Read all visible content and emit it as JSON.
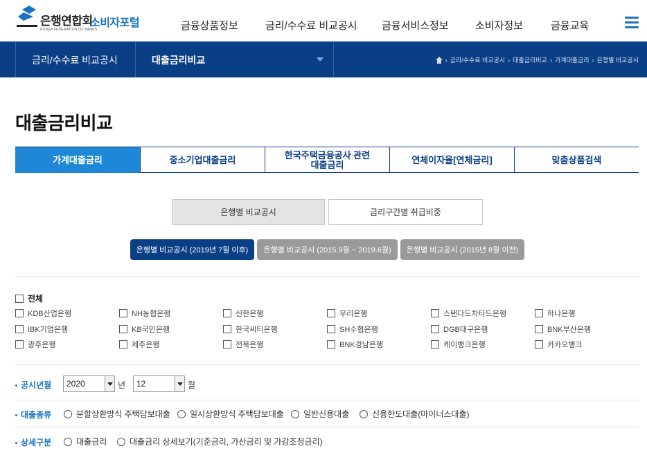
{
  "header": {
    "logo_kr": "은행연합회",
    "logo_en": "KOREA FEDERATION OF BANKS",
    "portal": "소비자포털",
    "nav": [
      "금융상품정보",
      "금리/수수료 비교공시",
      "금융서비스정보",
      "소비자정보",
      "금융교육"
    ]
  },
  "subnav": {
    "section": "금리/수수료 비교공시",
    "current": "대출금리비교",
    "breadcrumbs": [
      "금리/수수료 비교공시",
      "대출금리비교",
      "가계대출금리",
      "은행별 비교공시"
    ]
  },
  "page_title": "대출금리비교",
  "tabs": [
    {
      "line1": "가계대출금리",
      "line2": ""
    },
    {
      "line1": "중소기업대출금리",
      "line2": ""
    },
    {
      "line1": "한국주택금융공사 관련",
      "line2": "대출금리"
    },
    {
      "line1": "연체이자율[연체금리]",
      "line2": ""
    },
    {
      "line1": "맞춤상품검색",
      "line2": ""
    }
  ],
  "subtabs": [
    "은행별 비교공시",
    "금리구간별 취급비중"
  ],
  "pills": [
    "은행별 비교공시 (2019년 7월 이후)",
    "은행별 비교공시 (2015.9월 ~ 2019.6월)",
    "은행별 비교공시 (2015년 8월 이전)"
  ],
  "banks": {
    "all": "전체",
    "rows": [
      [
        "KDB산업은행",
        "NH농협은행",
        "신한은행",
        "우리은행",
        "스탠다드차타드은행",
        "하나은행"
      ],
      [
        "IBK기업은행",
        "KB국민은행",
        "한국씨티은행",
        "SH수협은행",
        "DGB대구은행",
        "BNK부산은행"
      ],
      [
        "광주은행",
        "제주은행",
        "전북은행",
        "BNK경남은행",
        "케이뱅크은행",
        "카카오뱅크"
      ]
    ]
  },
  "filters": {
    "period_label": "공시년월",
    "year": "2020",
    "year_unit": "년",
    "month": "12",
    "month_unit": "월",
    "type_label": "대출종류",
    "types": [
      "분할상환방식 주택담보대출",
      "일시상환방식 주택담보대출",
      "일반신용대출",
      "신용한도대출(마이너스대출)"
    ],
    "detail_label": "상세구분",
    "details": [
      "대출금리",
      "대출금리 상세보기(기준금리, 가산금리 및 가감조정금리)"
    ]
  },
  "colors": {
    "navy": "#0b3f85",
    "accent": "#1e88d6",
    "brand_blue": "#1a73c0"
  }
}
